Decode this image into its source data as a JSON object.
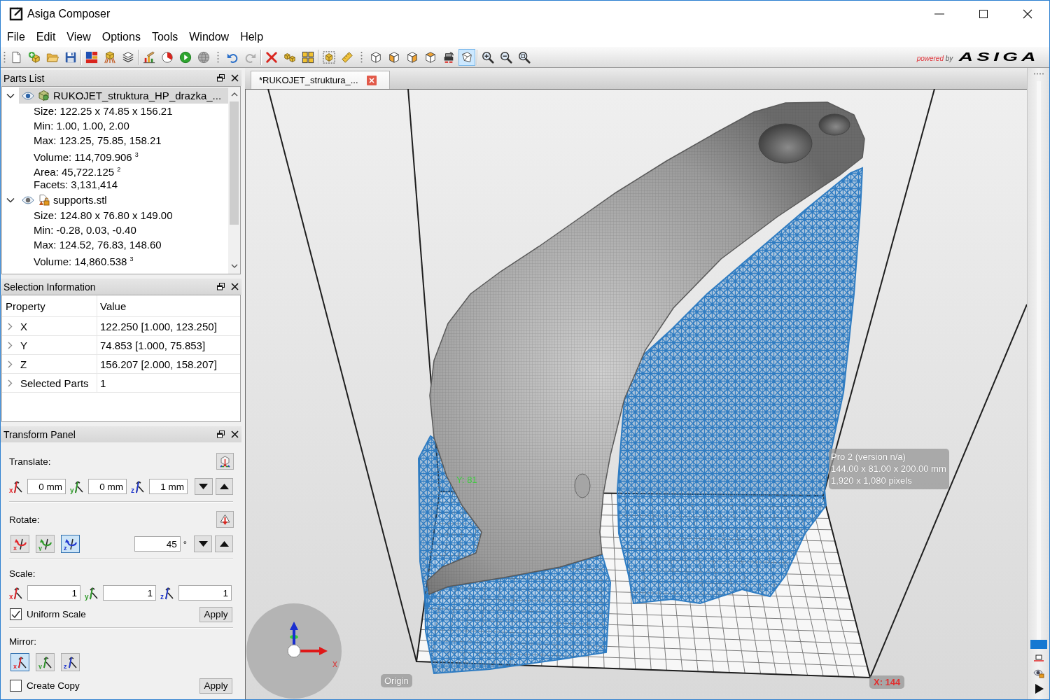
{
  "window": {
    "title": "Asiga Composer"
  },
  "menu": [
    "File",
    "Edit",
    "View",
    "Options",
    "Tools",
    "Window",
    "Help"
  ],
  "toolbar": {
    "sections": [
      {
        "groups": [
          [
            {
              "kind": "new",
              "selected": false,
              "disabled": false
            },
            {
              "kind": "add",
              "selected": false,
              "disabled": false
            },
            {
              "kind": "open",
              "selected": false,
              "disabled": false
            },
            {
              "kind": "save",
              "selected": false,
              "disabled": false
            }
          ],
          [
            {
              "kind": "layout",
              "selected": false,
              "disabled": false
            },
            {
              "kind": "supports",
              "selected": false,
              "disabled": false
            },
            {
              "kind": "slices",
              "selected": false,
              "disabled": false
            }
          ],
          [
            {
              "kind": "report",
              "selected": false,
              "disabled": false
            },
            {
              "kind": "timing",
              "selected": false,
              "disabled": false
            },
            {
              "kind": "build",
              "selected": false,
              "disabled": false
            },
            {
              "kind": "preview",
              "selected": false,
              "disabled": false
            }
          ]
        ]
      },
      {
        "groups": [
          [
            {
              "kind": "undo",
              "selected": false,
              "disabled": false
            },
            {
              "kind": "redo",
              "selected": false,
              "disabled": true
            }
          ],
          [
            {
              "kind": "delete",
              "selected": false,
              "disabled": false
            },
            {
              "kind": "duplicate",
              "selected": false,
              "disabled": false
            },
            {
              "kind": "arrange",
              "selected": false,
              "disabled": false
            }
          ],
          [
            {
              "kind": "select",
              "selected": false,
              "disabled": false
            },
            {
              "kind": "measure",
              "selected": false,
              "disabled": false
            }
          ]
        ]
      },
      {
        "groups": [
          [
            {
              "kind": "iso",
              "selected": false,
              "disabled": false
            },
            {
              "kind": "front",
              "selected": false,
              "disabled": false
            },
            {
              "kind": "side",
              "selected": false,
              "disabled": false
            },
            {
              "kind": "top",
              "selected": false,
              "disabled": false
            },
            {
              "kind": "printer",
              "selected": false,
              "disabled": false
            },
            {
              "kind": "perspective",
              "selected": true,
              "disabled": false
            }
          ],
          [
            {
              "kind": "zoomin",
              "selected": false,
              "disabled": false
            },
            {
              "kind": "zoomout",
              "selected": false,
              "disabled": false
            },
            {
              "kind": "zoomfit",
              "selected": false,
              "disabled": false
            }
          ]
        ]
      }
    ],
    "brand": {
      "tagline": "powered by",
      "logo": "ASIGA"
    }
  },
  "parts_list": {
    "title": "Parts List",
    "parts": [
      {
        "kind": "model",
        "name": "RUKOJET_struktura_HP_drazka_...",
        "expanded": true,
        "selected": true,
        "details": [
          "Size: 122.25 x 74.85 x 156.21",
          "Min: 1.00, 1.00, 2.00",
          "Max: 123.25, 75.85, 158.21",
          "Volume: 114,709.906 $^{3}$",
          "Area: 45,722.125 $^{2}$",
          "Facets: 3,131,414"
        ]
      },
      {
        "kind": "support",
        "name": "supports.stl",
        "expanded": true,
        "selected": false,
        "details": [
          "Size: 124.80 x 76.80 x 149.00",
          "Min: -0.28, 0.03, -0.40",
          "Max: 124.52, 76.83, 148.60",
          "Volume: 14,860.538 $^{3}$"
        ]
      }
    ]
  },
  "selection_information": {
    "title": "Selection Information",
    "columns": [
      "Property",
      "Value"
    ],
    "rows": [
      {
        "property": "X",
        "value": "122.250 [1.000, 123.250]",
        "expanded": false
      },
      {
        "property": "Y",
        "value": "74.853 [1.000, 75.853]",
        "expanded": false
      },
      {
        "property": "Z",
        "value": "156.207 [2.000, 158.207]",
        "expanded": false
      },
      {
        "property": "Selected Parts",
        "value": "1",
        "expanded": false
      }
    ]
  },
  "transform_panel": {
    "title": "Transform Panel",
    "translate": {
      "label": "Translate:",
      "fields": [
        {
          "axis": "x",
          "value": "0 mm"
        },
        {
          "axis": "y",
          "value": "0 mm"
        },
        {
          "axis": "z",
          "value": "1 mm"
        }
      ]
    },
    "rotate": {
      "label": "Rotate:",
      "axes": [
        {
          "axis": "x",
          "selected": false
        },
        {
          "axis": "y",
          "selected": false
        },
        {
          "axis": "z",
          "selected": true
        }
      ],
      "value": "45",
      "unit": "°"
    },
    "scale": {
      "label": "Scale:",
      "fields": [
        {
          "axis": "x",
          "value": "1"
        },
        {
          "axis": "y",
          "value": "1"
        },
        {
          "axis": "z",
          "value": "1"
        }
      ],
      "uniform": {
        "label": "Uniform Scale",
        "checked": true
      },
      "apply": "Apply"
    },
    "mirror": {
      "label": "Mirror:",
      "axes": [
        {
          "axis": "x",
          "selected": true
        },
        {
          "axis": "y",
          "selected": false
        },
        {
          "axis": "z",
          "selected": false
        }
      ],
      "copy": {
        "label": "Create Copy",
        "checked": false
      },
      "apply": "Apply"
    }
  },
  "document_tab": {
    "label": "*RUKOJET_struktura_..."
  },
  "viewport": {
    "y_axis_label": "Y: 81",
    "build_volume_info": [
      "Pro 2 (version n/a)",
      "144.00 x 81.00 x 200.00 mm",
      "1,920 x 1,080 pixels"
    ],
    "x_axis_label": "X: 144",
    "origin_label": "Origin",
    "gizmo_label": "x"
  },
  "layer_slider": {
    "level": 0
  }
}
